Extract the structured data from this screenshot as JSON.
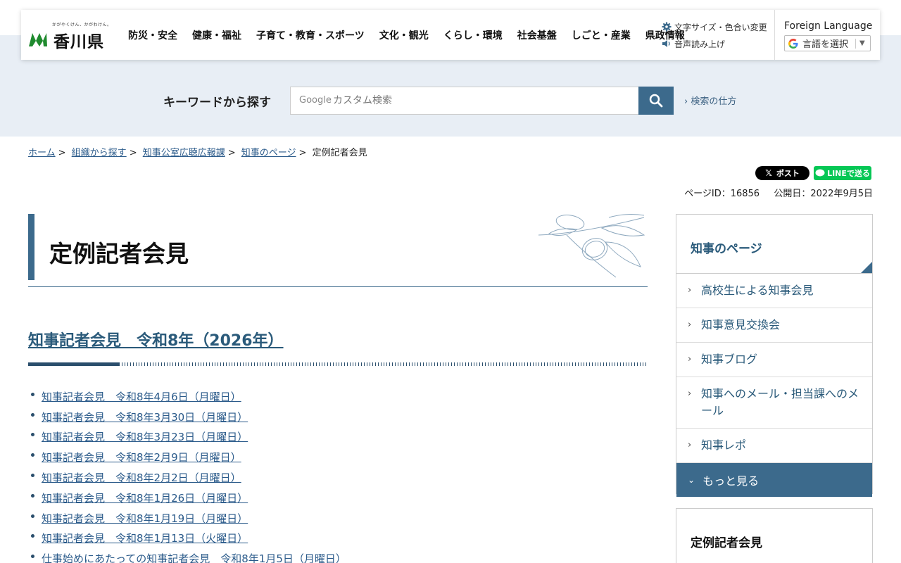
{
  "header": {
    "logo": {
      "tagline": "かがやくけん、かがわけん。",
      "name": "香川県"
    },
    "nav": [
      "防災・安全",
      "健康・福祉",
      "子育て・教育・スポーツ",
      "文化・観光",
      "くらし・環境",
      "社会基盤",
      "しごと・産業",
      "県政情報"
    ],
    "tools": {
      "font_color": "文字サイズ・色合い変更",
      "read_aloud": "音声読み上げ"
    },
    "language": {
      "label": "Foreign Language",
      "select": "言語を選択"
    }
  },
  "search": {
    "label": "キーワードから探す",
    "google": "Google",
    "placeholder": "カスタム検索",
    "how_to": "検索の仕方"
  },
  "breadcrumb": [
    "ホーム",
    "組織から探す",
    "知事公室広聴広報課",
    "知事のページ",
    "定例記者会見"
  ],
  "share": {
    "x": "ポスト",
    "line": "LINEで送る"
  },
  "meta": {
    "page_id": "ページID：16856",
    "published": "公開日：2022年9月5日"
  },
  "main": {
    "title": "定例記者会見",
    "section_heading": "知事記者会見　令和8年（2026年）",
    "items": [
      "知事記者会見　令和8年4月6日（月曜日）",
      "知事記者会見　令和8年3月30日（月曜日）",
      "知事記者会見　令和8年3月23日（月曜日）",
      "知事記者会見　令和8年2月9日（月曜日）",
      "知事記者会見　令和8年2月2日（月曜日）",
      "知事記者会見　令和8年1月26日（月曜日）",
      "知事記者会見　令和8年1月19日（月曜日）",
      "知事記者会見　令和8年1月13日（火曜日）",
      "仕事始めにあたっての知事記者会見　令和8年1月5日（月曜日）"
    ]
  },
  "sidebar": {
    "title": "知事のページ",
    "items": [
      "高校生による知事会見",
      "知事意見交換会",
      "知事ブログ",
      "知事へのメール・担当課へのメール",
      "知事レポ"
    ],
    "more": "もっと見る",
    "second_title": "定例記者会見"
  }
}
